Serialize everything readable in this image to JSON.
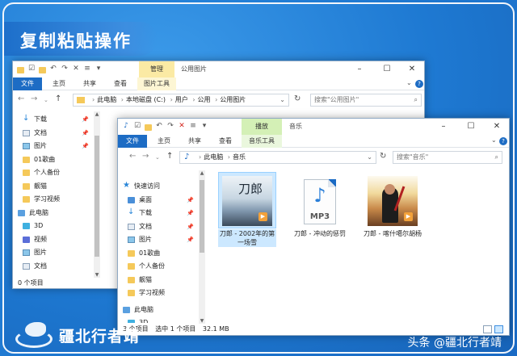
{
  "banner": {
    "title": "复制粘贴操作"
  },
  "window_back": {
    "context_tab": "管理",
    "title": "公用图片",
    "controls": [
      "–",
      "☐",
      "✕"
    ],
    "ribbon_tabs": [
      "文件",
      "主页",
      "共享",
      "查看",
      "图片工具"
    ],
    "address_parts": [
      "此电脑",
      "本地磁盘 (C:)",
      "用户",
      "公用",
      "公用图片"
    ],
    "search_placeholder": "搜索\"公用图片\"",
    "sidebar": [
      {
        "label": "下载",
        "icon": "download-icon",
        "pinned": true
      },
      {
        "label": "文档",
        "icon": "document-icon",
        "pinned": true
      },
      {
        "label": "图片",
        "icon": "pictures-icon",
        "pinned": true
      },
      {
        "label": "01歌曲",
        "icon": "folder-icon",
        "pinned": false
      },
      {
        "label": "个人备份",
        "icon": "folder-icon",
        "pinned": false
      },
      {
        "label": "靓猫",
        "icon": "folder-icon",
        "pinned": false
      },
      {
        "label": "学习视频",
        "icon": "folder-icon",
        "pinned": false
      },
      {
        "label": "此电脑",
        "icon": "pc-icon",
        "pinned": false
      },
      {
        "label": "3D",
        "icon": "3d-objects-icon",
        "pinned": false
      },
      {
        "label": "视频",
        "icon": "videos-icon",
        "pinned": false
      },
      {
        "label": "图片",
        "icon": "pictures-icon",
        "pinned": false
      },
      {
        "label": "文档",
        "icon": "document-icon",
        "pinned": false
      }
    ],
    "status": "0 个项目"
  },
  "window_front": {
    "context_tab": "播放",
    "title": "音乐",
    "controls": [
      "–",
      "☐",
      "✕"
    ],
    "ribbon_tabs": [
      "文件",
      "主页",
      "共享",
      "查看",
      "音乐工具"
    ],
    "address_parts": [
      "此电脑",
      "音乐"
    ],
    "search_placeholder": "搜索\"音乐\"",
    "sidebar": [
      {
        "label": "快速访问",
        "icon": "star-icon",
        "pinned": false
      },
      {
        "label": "桌面",
        "icon": "desktop-icon",
        "pinned": true
      },
      {
        "label": "下载",
        "icon": "download-icon",
        "pinned": true
      },
      {
        "label": "文档",
        "icon": "document-icon",
        "pinned": true
      },
      {
        "label": "图片",
        "icon": "pictures-icon",
        "pinned": true
      },
      {
        "label": "01歌曲",
        "icon": "folder-icon",
        "pinned": false
      },
      {
        "label": "个人备份",
        "icon": "folder-icon",
        "pinned": false
      },
      {
        "label": "靓猫",
        "icon": "folder-icon",
        "pinned": false
      },
      {
        "label": "学习视频",
        "icon": "folder-icon",
        "pinned": false
      },
      {
        "label": "此电脑",
        "icon": "pc-icon",
        "pinned": false
      },
      {
        "label": "3D",
        "icon": "3d-objects-icon",
        "pinned": false
      }
    ],
    "files": [
      {
        "name": "刀郎 - 2002年的第一场雪",
        "type": "album",
        "cover_text": "刀郎",
        "selected": true
      },
      {
        "name": "刀郎 - 冲动的惩罚",
        "type": "mp3",
        "ext_label": "MP3",
        "selected": false
      },
      {
        "name": "刀郎 - 喀什噶尔胡杨",
        "type": "album2",
        "selected": false
      }
    ],
    "status": {
      "count": "3 个项目",
      "selected": "选中 1 个项目",
      "size": "32.1 MB"
    }
  },
  "watermark": {
    "text": "疆北行者靖",
    "source": "头条 @疆北行者靖"
  },
  "colors": {
    "accent": "#1d6cc4",
    "selection": "#cce8ff",
    "folder": "#f5c95a"
  }
}
